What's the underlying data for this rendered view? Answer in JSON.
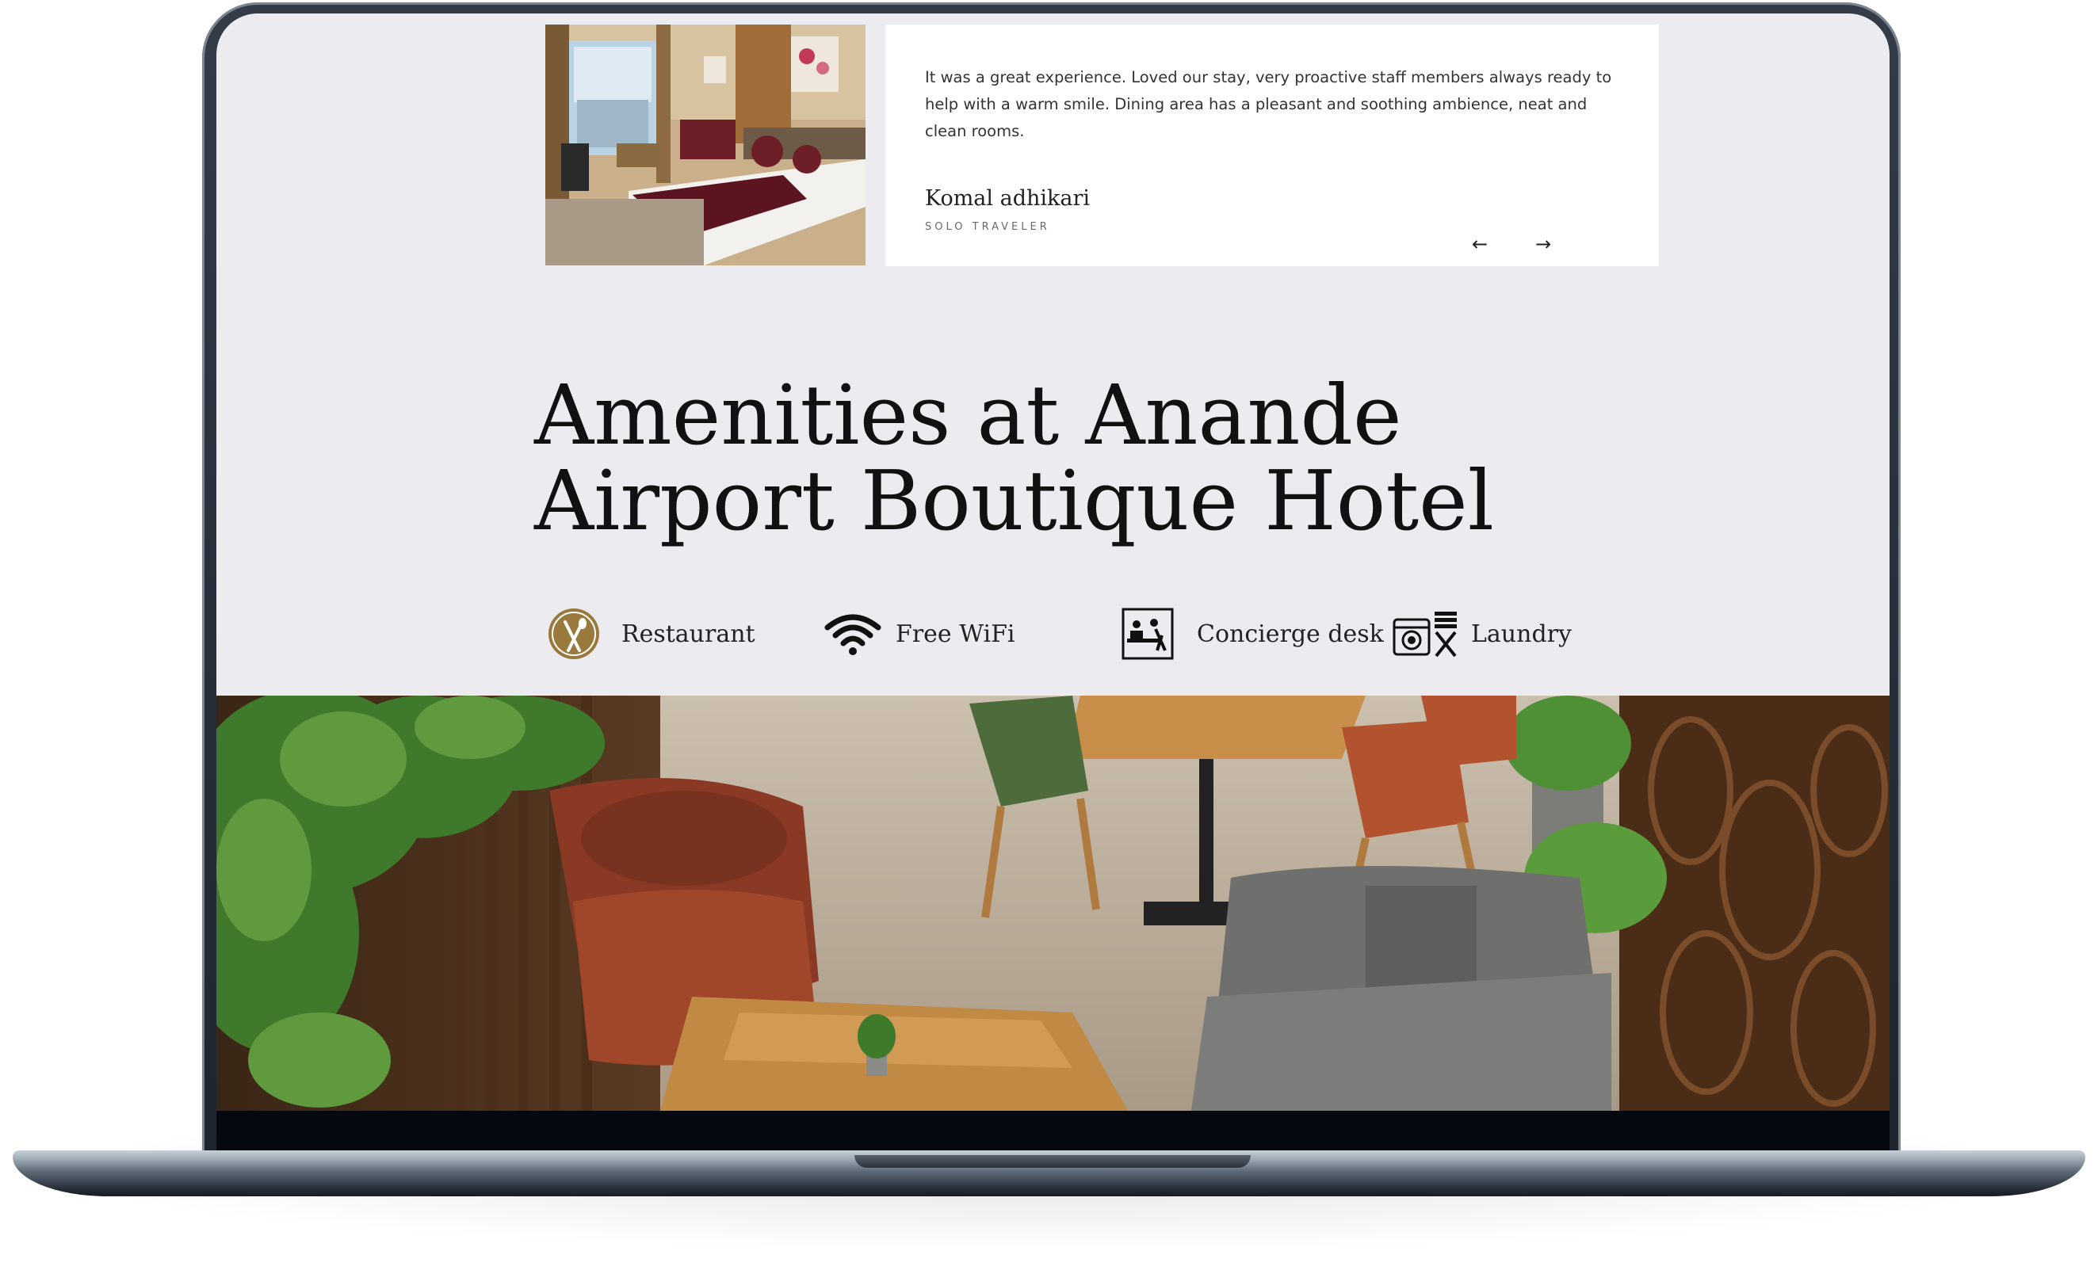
{
  "testimonial": {
    "quote": "It was a great experience. Loved our stay, very proactive staff members always ready to help with a warm smile. Dining area has a pleasant and soothing ambience, neat and clean rooms.",
    "author": "Komal adhikari",
    "role": "SOLO TRAVELER",
    "prev_arrow": "←",
    "next_arrow": "→"
  },
  "amenities": {
    "title": "Amenities at Anande Airport Boutique Hotel",
    "items": [
      {
        "label": "Restaurant",
        "icon": "restaurant-icon"
      },
      {
        "label": "Free WiFi",
        "icon": "wifi-icon"
      },
      {
        "label": "Concierge desk",
        "icon": "concierge-icon"
      },
      {
        "label": "Laundry",
        "icon": "laundry-icon"
      }
    ]
  },
  "colors": {
    "page_background": "#ecebf0",
    "accent_gold": "#9a7a3c",
    "text_dark": "#111111",
    "laptop_bezel": "#1f252e"
  }
}
